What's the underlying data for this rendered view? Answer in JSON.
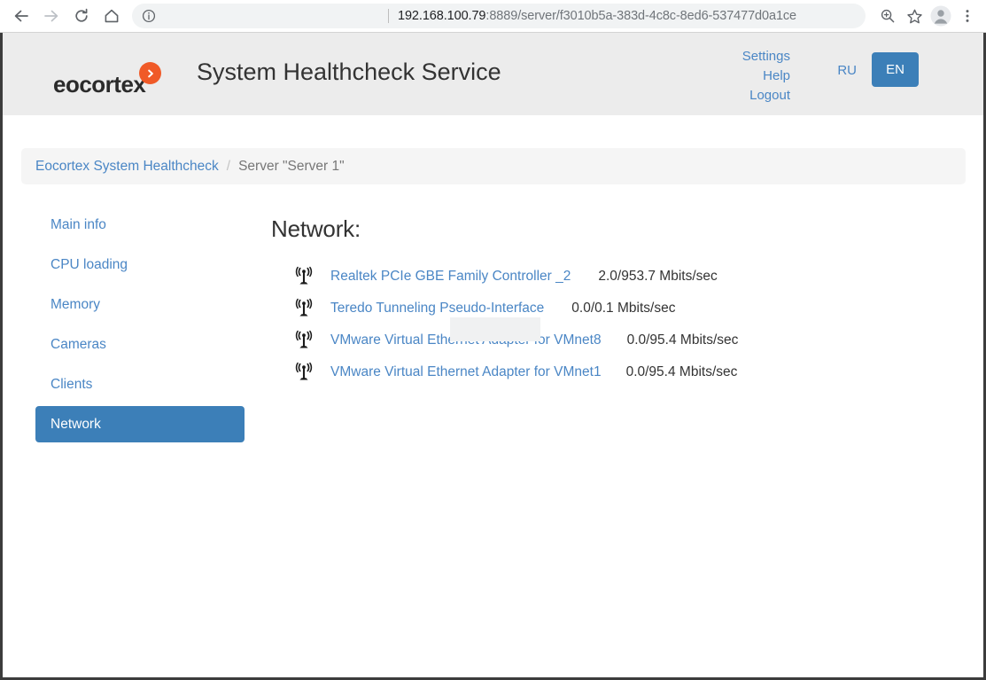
{
  "browser": {
    "back_icon": "back-arrow-icon",
    "forward_icon": "forward-arrow-icon",
    "reload_icon": "reload-icon",
    "home_icon": "home-icon",
    "info_icon": "page-info-icon",
    "url_host": "192.168.100.79",
    "url_path": ":8889/server/f3010b5a-383d-4c8c-8ed6-537477d0a1ce",
    "zoom_icon": "zoom-in-icon",
    "bookmark_icon": "star-icon",
    "profile_icon": "profile-avatar-icon",
    "menu_icon": "three-dot-menu-icon"
  },
  "header": {
    "logo_text": "eocortex",
    "logo_badge_icon": "chevron-right-icon",
    "title": "System Healthcheck Service",
    "links": [
      {
        "label": "Settings"
      },
      {
        "label": "Help"
      },
      {
        "label": "Logout"
      }
    ],
    "lang_ru": "RU",
    "lang_en": "EN",
    "accent_blue": "#3c7fb8",
    "link_blue": "#4a86c5",
    "logo_orange": "#f05a28",
    "header_bg": "#ececec"
  },
  "breadcrumb": {
    "root": "Eocortex System Healthcheck",
    "separator": "/",
    "current": "Server \"Server 1\""
  },
  "sidebar": {
    "items": [
      {
        "label": "Main info",
        "active": false
      },
      {
        "label": "CPU loading",
        "active": false
      },
      {
        "label": "Memory",
        "active": false
      },
      {
        "label": "Cameras",
        "active": false
      },
      {
        "label": "Clients",
        "active": false
      },
      {
        "label": "Network",
        "active": true
      }
    ]
  },
  "main": {
    "section_title": "Network:",
    "adapter_icon": "network-antenna-icon",
    "adapters": [
      {
        "name": "Realtek PCIe GBE Family Controller _2",
        "speed": "2.0/953.7 Mbits/sec"
      },
      {
        "name": "Teredo Tunneling Pseudo-Interface",
        "speed": "0.0/0.1 Mbits/sec"
      },
      {
        "name": "VMware Virtual Ethernet Adapter for VMnet8",
        "speed": "0.0/95.4 Mbits/sec"
      },
      {
        "name": "VMware Virtual Ethernet Adapter for VMnet1",
        "speed": "0.0/95.4 Mbits/sec"
      }
    ]
  }
}
